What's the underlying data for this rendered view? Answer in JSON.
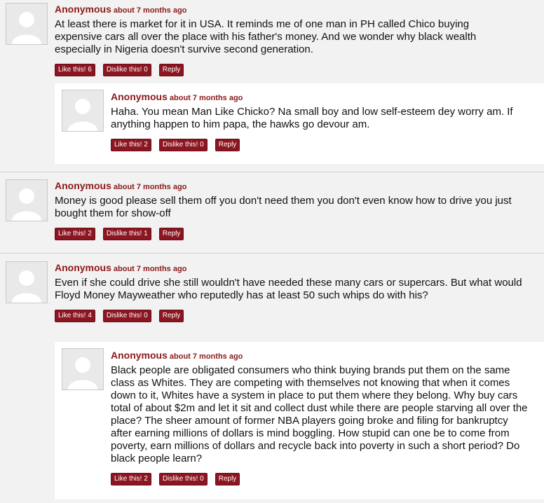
{
  "comments": [
    {
      "author": "Anonymous",
      "time": "about 7 months ago",
      "text": "At least there is market for it in USA. It reminds me of one man in PH called Chico buying expensive cars all over the place with his father's money. And we wonder why black wealth especially in Nigeria doesn't survive second generation.",
      "like": "Like this! 6",
      "dislike": "Dislike this! 0",
      "reply": "Reply",
      "replies": [
        {
          "author": "Anonymous",
          "time": "about 7 months ago",
          "text": "Haha. You mean Man Like Chicko? Na small boy and low self-esteem dey worry am. If anything happen to him papa, the hawks go devour am.",
          "like": "Like this! 2",
          "dislike": "Dislike this! 0",
          "reply": "Reply"
        }
      ]
    },
    {
      "author": "Anonymous",
      "time": "about 7 months ago",
      "text": "Money is good please sell them off you don't need them you don't even know how to drive you just bought them for show-off",
      "like": "Like this! 2",
      "dislike": "Dislike this! 1",
      "reply": "Reply"
    },
    {
      "author": "Anonymous",
      "time": "about 7 months ago",
      "text": "Even if she could drive she still wouldn't have needed these many cars or supercars. But what would Floyd Money Mayweather who reputedly has at least 50 such whips do with his?",
      "like": "Like this! 4",
      "dislike": "Dislike this! 0",
      "reply": "Reply",
      "replies": [
        {
          "author": "Anonymous",
          "time": "about 7 months ago",
          "text": "Black people are obligated consumers who think buying brands put them on the same class as Whites. They are competing with themselves not knowing that when it comes down to it, Whites have a system in place to put them where they belong. Why buy cars total of about $2m and let it sit and collect dust while there are people starving all over the place? The sheer amount of former NBA players going broke and filing for bankruptcy after earning millions of dollars is mind boggling. How stupid can one be to come from poverty, earn millions of dollars and recycle back into poverty in such a short period? Do black people learn?",
          "like": "Like this! 2",
          "dislike": "Dislike this! 0",
          "reply": "Reply"
        }
      ]
    }
  ]
}
